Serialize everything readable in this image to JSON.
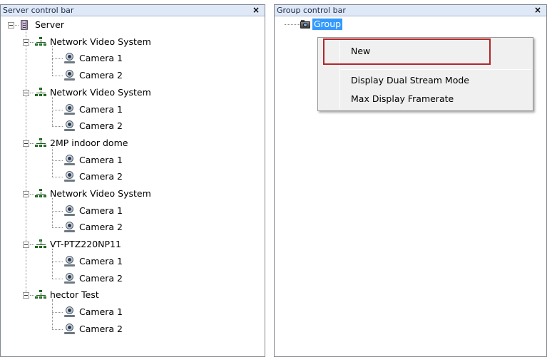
{
  "left_panel": {
    "title": "Server control bar",
    "close_glyph": "×",
    "root": {
      "label": "Server",
      "icon": "server-icon"
    },
    "devices": [
      {
        "label": "Network Video System",
        "icon": "network-icon",
        "cameras": [
          "Camera 1",
          "Camera 2"
        ]
      },
      {
        "label": "Network Video System",
        "icon": "network-icon",
        "cameras": [
          "Camera 1",
          "Camera 2"
        ]
      },
      {
        "label": "2MP indoor dome",
        "icon": "network-icon",
        "cameras": [
          "Camera 1",
          "Camera 2"
        ]
      },
      {
        "label": "Network Video System",
        "icon": "network-icon",
        "cameras": [
          "Camera 1",
          "Camera 2"
        ]
      },
      {
        "label": "VT-PTZ220NP11",
        "icon": "network-icon",
        "cameras": [
          "Camera 1",
          "Camera 2"
        ]
      },
      {
        "label": "hector Test",
        "icon": "network-icon",
        "cameras": [
          "Camera 1",
          "Camera 2"
        ]
      }
    ],
    "camera_icon": "camera-icon"
  },
  "right_panel": {
    "title": "Group control bar",
    "close_glyph": "×",
    "group": {
      "label": "Group",
      "icon": "group-camera-icon",
      "selected": true
    }
  },
  "context_menu": {
    "items": [
      {
        "label": "New",
        "highlighted": true
      },
      {
        "label": "Display Dual Stream Mode"
      },
      {
        "label": "Max Display Framerate"
      }
    ]
  },
  "colors": {
    "titlebar": "#dfe8f6",
    "selection": "#3399ff",
    "highlight_border": "#b2262a",
    "menu_bg": "#f0f0f0"
  }
}
